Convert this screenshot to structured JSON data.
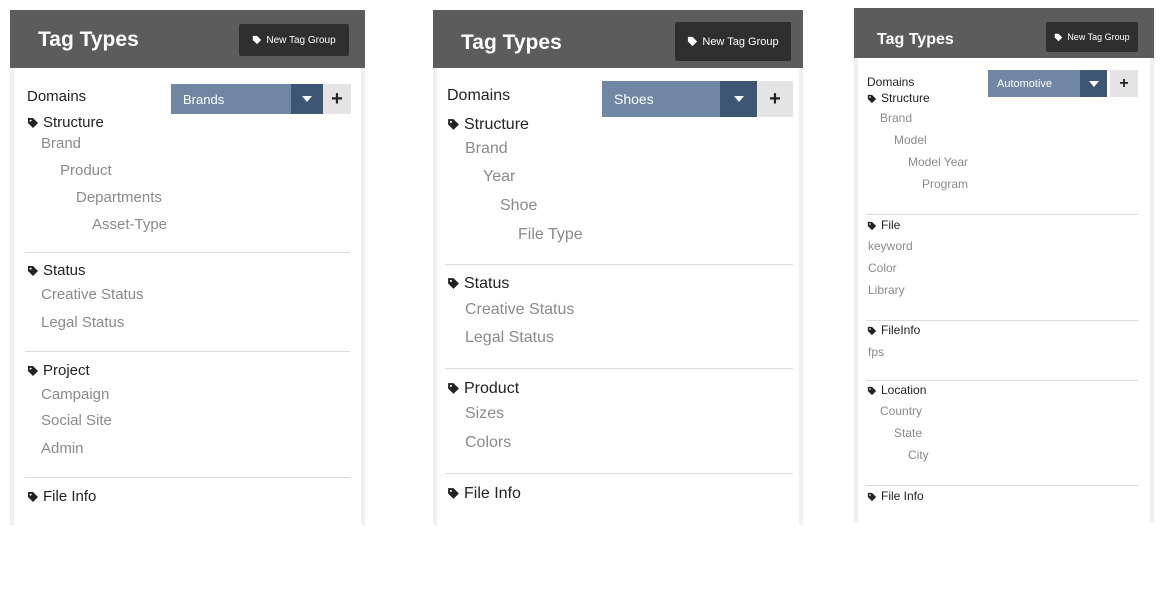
{
  "panels": [
    {
      "header": {
        "title": "Tag Types",
        "new_button": "New Tag Group"
      },
      "domains": {
        "label": "Domains",
        "selected": "Brands",
        "add_label": "+"
      },
      "groups": [
        {
          "title": "Structure",
          "items": [
            "Brand",
            "Product",
            "Departments",
            "Asset-Type"
          ]
        },
        {
          "title": "Status",
          "items": [
            "Creative Status",
            "Legal Status"
          ]
        },
        {
          "title": "Project",
          "items": [
            "Campaign",
            "Social Site",
            "Admin"
          ]
        },
        {
          "title": "File Info",
          "items": []
        }
      ]
    },
    {
      "header": {
        "title": "Tag Types",
        "new_button": "New Tag Group"
      },
      "domains": {
        "label": "Domains",
        "selected": "Shoes",
        "add_label": "+"
      },
      "groups": [
        {
          "title": "Structure",
          "items": [
            "Brand",
            "Year",
            "Shoe",
            "File Type"
          ]
        },
        {
          "title": "Status",
          "items": [
            "Creative Status",
            "Legal Status"
          ]
        },
        {
          "title": "Product",
          "items": [
            "Sizes",
            "Colors"
          ]
        },
        {
          "title": "File Info",
          "items": []
        }
      ]
    },
    {
      "header": {
        "title": "Tag Types",
        "new_button": "New Tag Group"
      },
      "domains": {
        "label": "Domains",
        "selected": "Automotive",
        "add_label": "+"
      },
      "groups": [
        {
          "title": "Structure",
          "items": [
            "Brand",
            "Model",
            "Model Year",
            "Program"
          ]
        },
        {
          "title": "File",
          "items": [
            "keyword",
            "Color",
            "Library"
          ]
        },
        {
          "title": "FileInfo",
          "items": [
            "fps"
          ]
        },
        {
          "title": "Location",
          "items": [
            "Country",
            "State",
            "City"
          ]
        },
        {
          "title": "File Info",
          "items": []
        }
      ]
    }
  ],
  "colors": {
    "header_bg": "#5c5c5c",
    "button_bg": "#2f2f2f",
    "select_bg": "#6f87a3",
    "select_arrow_bg": "#3d5673",
    "item_text": "#8a8a8a"
  },
  "icons": {
    "tag": "tag-icon",
    "arrow": "chevron-down-icon",
    "plus": "plus-icon"
  }
}
